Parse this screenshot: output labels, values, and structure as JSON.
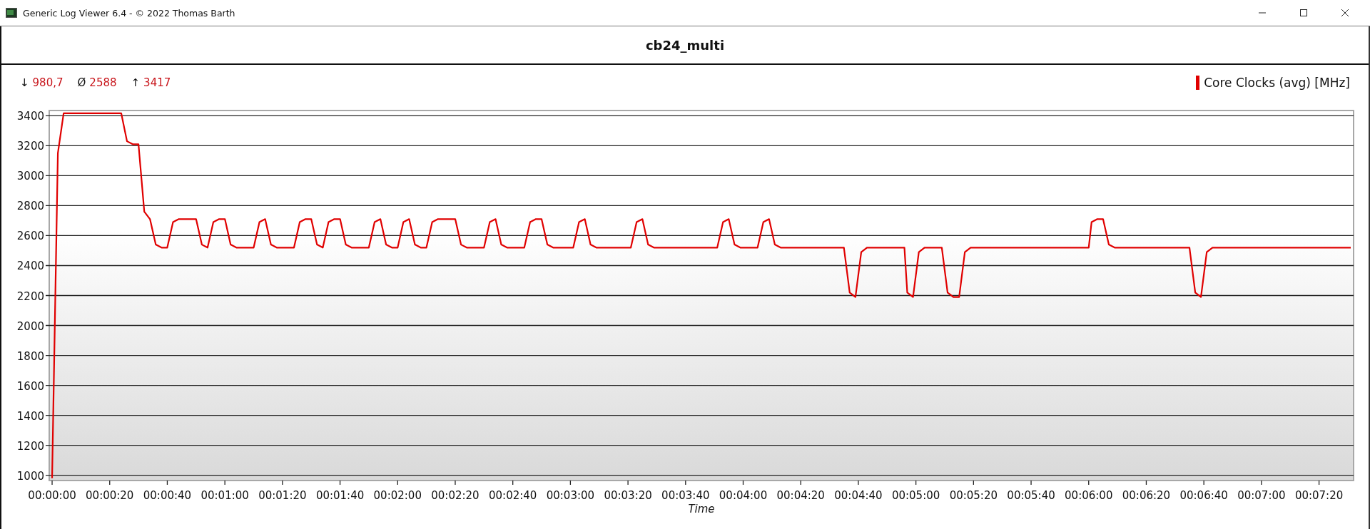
{
  "window": {
    "title": "Generic Log Viewer 6.4 - © 2022 Thomas Barth"
  },
  "stats": [
    {
      "symbol": "↓",
      "value": "980,7"
    },
    {
      "symbol": "Ø",
      "value": "2588"
    },
    {
      "symbol": "↑",
      "value": "3417"
    }
  ],
  "chart": {
    "chart_data": {
      "type": "line",
      "title": "cb24_multi",
      "xlabel": "Time",
      "grid": true,
      "x": [
        0,
        2,
        4,
        24,
        26,
        28,
        30,
        32,
        34,
        36,
        38,
        40,
        42,
        44,
        50,
        52,
        54,
        56,
        58,
        60,
        62,
        64,
        70,
        72,
        74,
        76,
        78,
        84,
        86,
        88,
        90,
        92,
        94,
        96,
        98,
        100,
        102,
        104,
        110,
        112,
        114,
        116,
        118,
        120,
        122,
        124,
        126,
        128,
        130,
        132,
        134,
        140,
        142,
        144,
        150,
        152,
        154,
        156,
        158,
        164,
        166,
        168,
        170,
        172,
        174,
        181,
        183,
        185,
        187,
        189,
        201,
        203,
        205,
        207,
        209,
        231,
        233,
        235,
        237,
        239,
        245,
        247,
        249,
        251,
        253,
        275,
        277,
        279,
        281,
        283,
        296,
        297,
        299,
        301,
        303,
        309,
        311,
        313,
        315,
        317,
        319,
        360,
        361,
        363,
        365,
        367,
        369,
        395,
        397,
        399,
        401,
        403,
        451
      ],
      "series": [
        {
          "name": "Core Clocks (avg) [MHz]",
          "color": "#e00000",
          "values": [
            980,
            3150,
            3417,
            3417,
            3230,
            3210,
            3210,
            2760,
            2710,
            2540,
            2520,
            2520,
            2690,
            2710,
            2710,
            2540,
            2520,
            2690,
            2710,
            2710,
            2540,
            2520,
            2520,
            2690,
            2710,
            2540,
            2520,
            2520,
            2690,
            2710,
            2710,
            2540,
            2520,
            2690,
            2710,
            2710,
            2540,
            2520,
            2520,
            2690,
            2710,
            2540,
            2520,
            2520,
            2690,
            2710,
            2540,
            2520,
            2520,
            2690,
            2710,
            2710,
            2540,
            2520,
            2520,
            2690,
            2710,
            2540,
            2520,
            2520,
            2690,
            2710,
            2710,
            2540,
            2520,
            2520,
            2690,
            2710,
            2540,
            2520,
            2520,
            2690,
            2710,
            2540,
            2520,
            2520,
            2690,
            2710,
            2540,
            2520,
            2520,
            2690,
            2710,
            2540,
            2520,
            2520,
            2220,
            2190,
            2490,
            2520,
            2520,
            2220,
            2190,
            2490,
            2520,
            2520,
            2220,
            2190,
            2190,
            2490,
            2520,
            2520,
            2690,
            2710,
            2710,
            2540,
            2520,
            2520,
            2220,
            2190,
            2490,
            2520,
            2520
          ]
        }
      ],
      "xlim": [
        -1,
        452
      ],
      "ylim": [
        965,
        3435
      ],
      "xticks": [
        {
          "value": 0,
          "label": "00:00:00"
        },
        {
          "value": 20,
          "label": "00:00:20"
        },
        {
          "value": 40,
          "label": "00:00:40"
        },
        {
          "value": 60,
          "label": "00:01:00"
        },
        {
          "value": 80,
          "label": "00:01:20"
        },
        {
          "value": 100,
          "label": "00:01:40"
        },
        {
          "value": 120,
          "label": "00:02:00"
        },
        {
          "value": 140,
          "label": "00:02:20"
        },
        {
          "value": 160,
          "label": "00:02:40"
        },
        {
          "value": 180,
          "label": "00:03:00"
        },
        {
          "value": 200,
          "label": "00:03:20"
        },
        {
          "value": 220,
          "label": "00:03:40"
        },
        {
          "value": 240,
          "label": "00:04:00"
        },
        {
          "value": 260,
          "label": "00:04:20"
        },
        {
          "value": 280,
          "label": "00:04:40"
        },
        {
          "value": 300,
          "label": "00:05:00"
        },
        {
          "value": 320,
          "label": "00:05:20"
        },
        {
          "value": 340,
          "label": "00:05:40"
        },
        {
          "value": 360,
          "label": "00:06:00"
        },
        {
          "value": 380,
          "label": "00:06:20"
        },
        {
          "value": 400,
          "label": "00:06:40"
        },
        {
          "value": 420,
          "label": "00:07:00"
        },
        {
          "value": 440,
          "label": "00:07:20"
        }
      ],
      "yticks": [
        1000,
        1200,
        1400,
        1600,
        1800,
        2000,
        2200,
        2400,
        2600,
        2800,
        3000,
        3200,
        3400
      ]
    }
  }
}
